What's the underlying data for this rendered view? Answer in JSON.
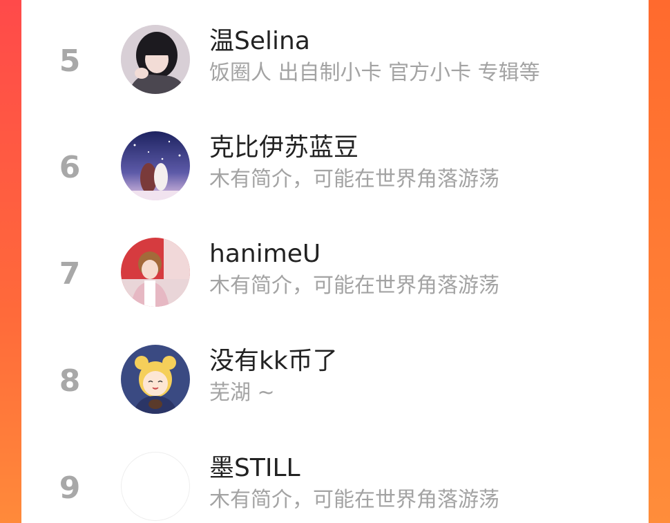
{
  "rows": [
    {
      "rank": "5",
      "name": "温Selina",
      "bio": "饭圈人 出自制小卡 官方小卡 专辑等",
      "avatar": "avatar-dark-hair-girl"
    },
    {
      "rank": "6",
      "name": "克比伊苏蓝豆",
      "bio": "木有简介，可能在世界角落游荡",
      "avatar": "avatar-anime-starry-night"
    },
    {
      "rank": "7",
      "name": "hanimeU",
      "bio": "木有简介，可能在世界角落游荡",
      "avatar": "avatar-boy-red-backdrop"
    },
    {
      "rank": "8",
      "name": "没有kk币了",
      "bio": "芜湖 ~",
      "avatar": "avatar-cartoon-blonde-buns"
    },
    {
      "rank": "9",
      "name": "墨STILL",
      "bio": "木有简介，可能在世界角落游荡",
      "avatar": "avatar-blank"
    }
  ]
}
